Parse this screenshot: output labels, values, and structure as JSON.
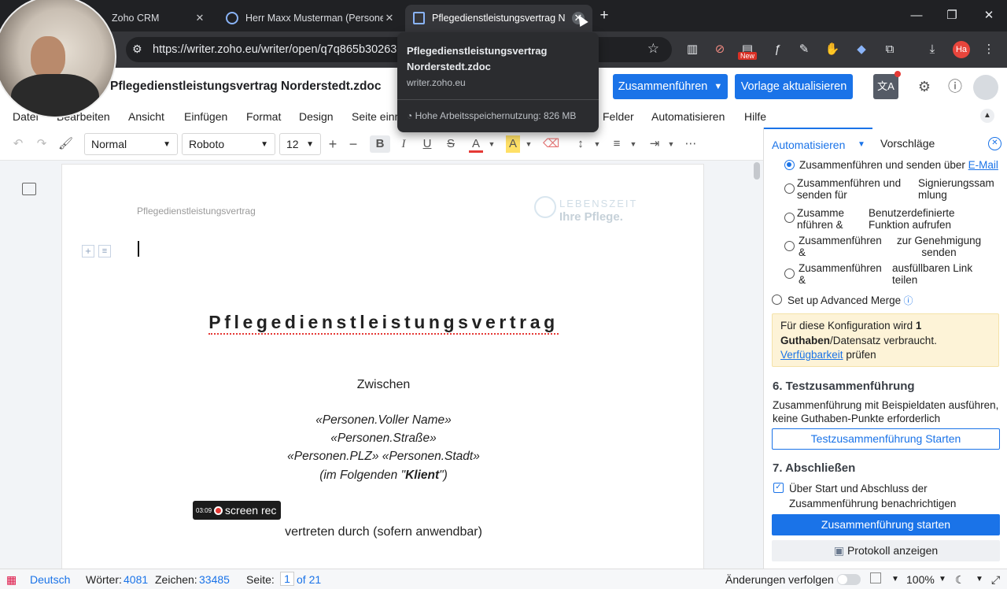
{
  "browser": {
    "tabs": [
      {
        "title": "Zoho CRM"
      },
      {
        "title": "Herr Maxx Musterman (Persone"
      },
      {
        "title": "Pflegedienstleistungsvertrag N"
      }
    ],
    "url": "https://writer.zoho.eu/writer/open/q7q865b30263",
    "profile_initials": "Ha",
    "new_badge": "New"
  },
  "tooltip": {
    "title": "Pflegedienstleistungsvertrag Norderstedt.zdoc",
    "host": "writer.zoho.eu",
    "memory": "Hohe Arbeitsspeichernutzung: 826 MB"
  },
  "writer": {
    "doc_title": "Pflegedienstleistungsvertrag Norderstedt.zdoc",
    "merge_button": "Zusammenführen",
    "update_template_button": "Vorlage aktualisieren",
    "menu": [
      "Datei",
      "Bearbeiten",
      "Ansicht",
      "Einfügen",
      "Format",
      "Design",
      "Seite einr",
      "Felder",
      "Automatisieren",
      "Hilfe"
    ],
    "toolbar": {
      "style": "Normal",
      "font": "Roboto",
      "size": "12"
    }
  },
  "document": {
    "header_text": "Pflegedienstleistungsvertrag",
    "logo_line1": "LEBENSZEIT",
    "logo_line2": "Ihre Pflege.",
    "heading": "Pflegedienstleistungsvertrag",
    "between": "Zwischen",
    "field_name": "«Personen.Voller Name»",
    "field_street": "«Personen.Straße»",
    "field_city": "«Personen.PLZ» «Personen.Stadt»",
    "client_prefix": "(im Folgenden \"",
    "client_bold": "Klient",
    "client_suffix": "\")",
    "represented": "vertreten durch (sofern anwendbar)",
    "rec_time": "03:09",
    "rec_label": "screen rec"
  },
  "panel": {
    "tab_automate": "Automatisieren",
    "tab_suggestions": "Vorschläge",
    "options": [
      {
        "a": "Zusammenführen und senden über",
        "link": "E-Mail"
      },
      {
        "a": "Zusammenführen und senden für",
        "b": "Signierungssammlung"
      },
      {
        "a": "Zusammenführen &",
        "b": "Benutzerdefinierte Funktion aufrufen"
      },
      {
        "a": "Zusammenführen &",
        "b": "zur Genehmigung senden"
      },
      {
        "a": "Zusammenführen &",
        "b": "ausfüllbaren Link teilen"
      }
    ],
    "advanced": "Set up Advanced Merge",
    "notice_1": "Für diese Konfiguration wird ",
    "notice_bold1": "1",
    "notice_bold2": "Guthaben",
    "notice_2": "/Datensatz verbraucht.",
    "notice_link": "Verfügbarkeit",
    "notice_3": " prüfen",
    "section6": "6. Testzusammenführung",
    "section6_desc": "Zusammenführung mit Beispieldaten ausführen, keine Guthaben-Punkte erforderlich",
    "test_button": "Testzusammenführung Starten",
    "section7": "7. Abschließen",
    "notify_label": "Über Start und Abschluss der Zusammenführung benachrichtigen",
    "start_button": "Zusammenführung starten",
    "log_button": "Protokoll anzeigen"
  },
  "status": {
    "language": "Deutsch",
    "words_label": "Wörter:",
    "words": "4081",
    "chars_label": "Zeichen:",
    "chars": "33485",
    "page_label": "Seite:",
    "page": "1",
    "of_pages": "of 21",
    "track_changes": "Änderungen verfolgen",
    "zoom": "100%"
  }
}
